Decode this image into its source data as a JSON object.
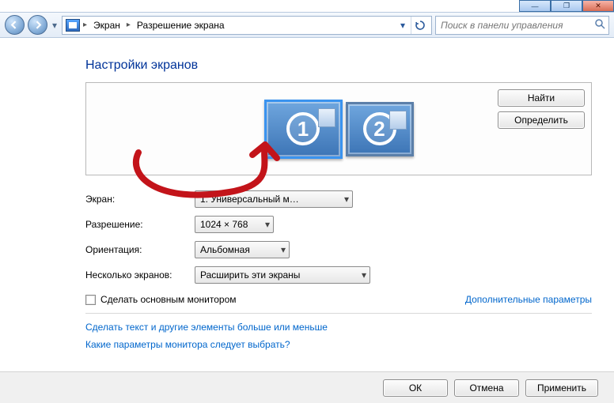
{
  "window_controls": {
    "minimize": "—",
    "maximize": "❐",
    "close": "✕"
  },
  "breadcrumb": {
    "segments": [
      "Экран",
      "Разрешение экрана"
    ]
  },
  "search": {
    "placeholder": "Поиск в панели управления"
  },
  "page": {
    "title": "Настройки экранов"
  },
  "displays_box": {
    "monitors": [
      {
        "number": "1",
        "primary": true
      },
      {
        "number": "2",
        "primary": false
      }
    ],
    "find_btn": "Найти",
    "identify_btn": "Определить"
  },
  "form": {
    "display_label": "Экран:",
    "display_value": "1. Универсальный м…",
    "resolution_label": "Разрешение:",
    "resolution_value": "1024 × 768",
    "orientation_label": "Ориентация:",
    "orientation_value": "Альбомная",
    "multidisplay_label": "Несколько экранов:",
    "multidisplay_value": "Расширить эти экраны"
  },
  "checkbox": {
    "label": "Сделать основным монитором",
    "checked": false
  },
  "links": {
    "advanced": "Дополнительные параметры",
    "make_text_bigger": "Сделать текст и другие элементы больше или меньше",
    "which_monitor": "Какие параметры монитора следует выбрать?"
  },
  "footer": {
    "ok": "ОК",
    "cancel": "Отмена",
    "apply": "Применить"
  }
}
